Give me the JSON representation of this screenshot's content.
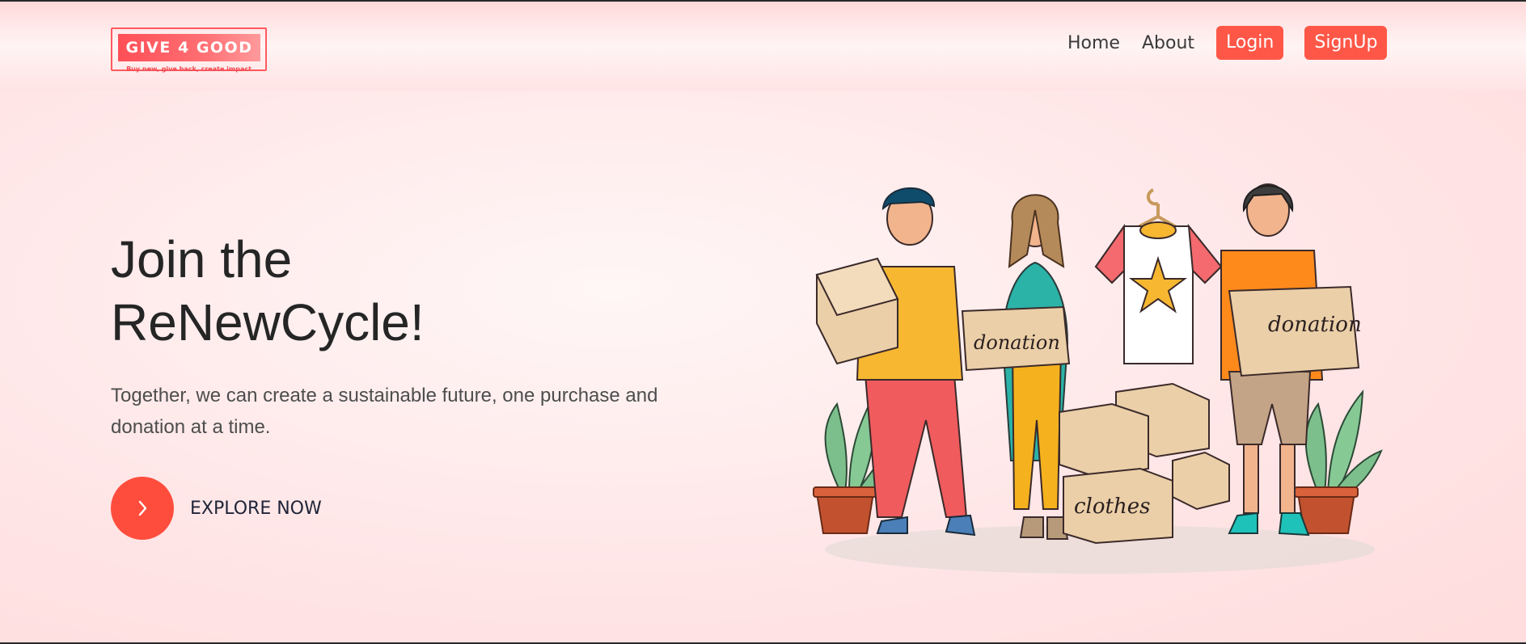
{
  "logo": {
    "title": "GIVE 4 GOOD",
    "tagline": "Buy new, give back, create impact",
    "color": "#ff5a5f"
  },
  "nav": {
    "home": "Home",
    "about": "About",
    "login": "Login",
    "signup": "SignUp",
    "button_color": "#ff5747"
  },
  "hero": {
    "title_line1": "Join the",
    "title_line2": "ReNewCycle!",
    "subtitle": "Together, we can create a sustainable future, one purchase and donation at a time.",
    "cta_label": "EXPLORE NOW",
    "cta_icon": "chevron-right-icon"
  },
  "illustration": {
    "box_label_1": "donation",
    "box_label_2": "donation",
    "box_label_3": "clothes"
  }
}
